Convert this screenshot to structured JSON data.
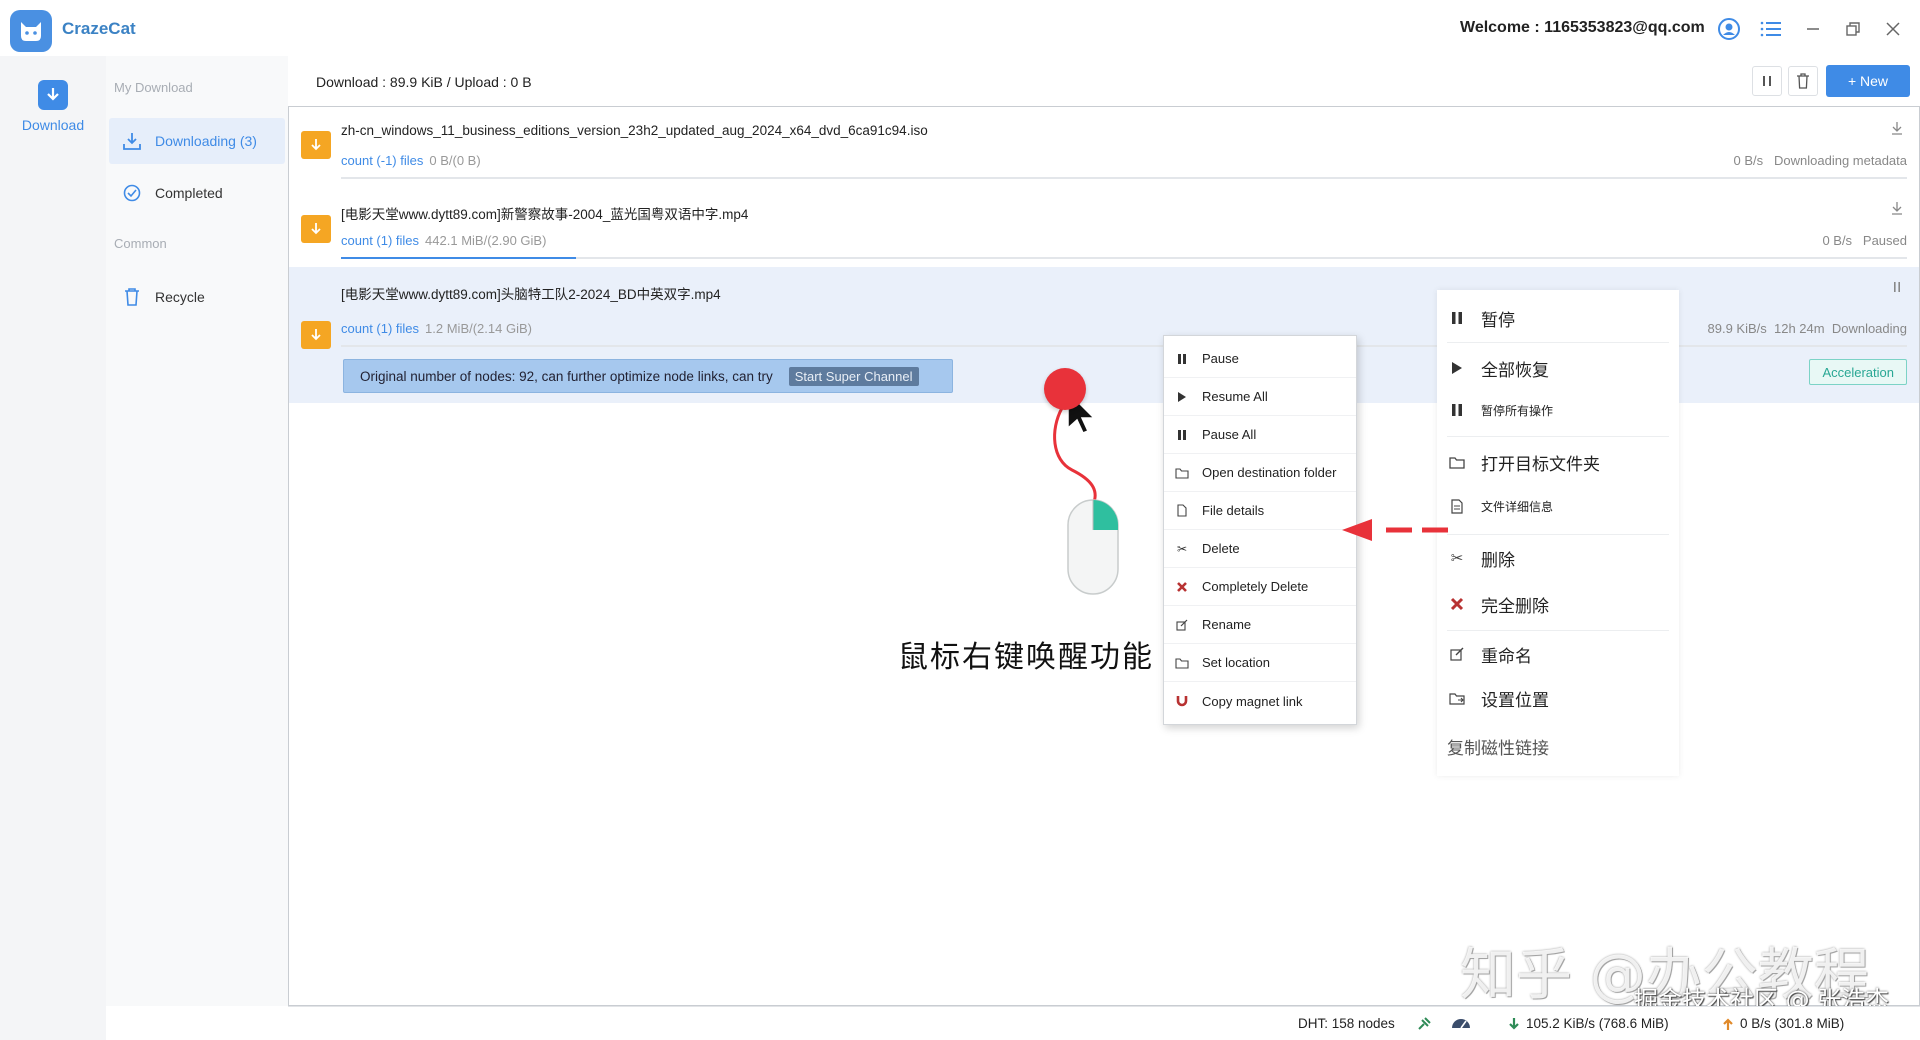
{
  "app": {
    "name": "CrazeCat",
    "welcome": "Welcome : 1165353823@qq.com"
  },
  "rail": {
    "download_label": "Download"
  },
  "sidebar": {
    "section_my": "My Download",
    "section_common": "Common",
    "items": [
      {
        "label": "Downloading (3)"
      },
      {
        "label": "Completed"
      },
      {
        "label": "Recycle"
      }
    ]
  },
  "topbar": {
    "stats": "Download : 89.9 KiB / Upload : 0 B",
    "new_label": "+ New"
  },
  "tasks": [
    {
      "name": "zh-cn_windows_11_business_editions_version_23h2_updated_aug_2024_x64_dvd_6ca91c94.iso",
      "count": "count (-1) files",
      "size": "0 B/(0 B)",
      "speed": "0 B/s",
      "status": "Downloading metadata",
      "progress": 0
    },
    {
      "name": "[电影天堂www.dytt89.com]新警察故事-2004_蓝光国粤双语中字.mp4",
      "count": "count (1) files",
      "size": "442.1 MiB/(2.90 GiB)",
      "speed": "0 B/s",
      "status": "Paused",
      "progress": 0.15
    },
    {
      "name": "[电影天堂www.dytt89.com]头脑特工队2-2024_BD中英双字.mp4",
      "count": "count (1) files",
      "size": "1.2 MiB/(2.14 GiB)",
      "speed": "89.9 KiB/s",
      "eta": "12h 24m",
      "status": "Downloading",
      "progress": 0.0
    }
  ],
  "notice": {
    "text": "Original number of nodes: 92, can further optimize node links, can try",
    "button": "Start Super Channel"
  },
  "acceleration_label": "Acceleration",
  "context_menu": [
    {
      "label": "Pause",
      "icon": "pause-icon"
    },
    {
      "label": "Resume All",
      "icon": "play-icon"
    },
    {
      "label": "Pause All",
      "icon": "pause-icon"
    },
    {
      "label": "Open destination folder",
      "icon": "folder-icon"
    },
    {
      "label": "File details",
      "icon": "file-icon"
    },
    {
      "label": "Delete",
      "icon": "scissors-icon"
    },
    {
      "label": "Completely Delete",
      "icon": "x-icon"
    },
    {
      "label": "Rename",
      "icon": "edit-icon"
    },
    {
      "label": "Set location",
      "icon": "location-icon"
    },
    {
      "label": "Copy magnet link",
      "icon": "magnet-icon"
    }
  ],
  "cn_menu": [
    {
      "label": "暂停"
    },
    {
      "label": "全部恢复"
    },
    {
      "label": "暂停所有操作"
    },
    {
      "label": "打开目标文件夹"
    },
    {
      "label": "文件详细信息"
    },
    {
      "label": "删除"
    },
    {
      "label": "完全删除"
    },
    {
      "label": "重命名"
    },
    {
      "label": "设置位置"
    },
    {
      "label": "复制磁性链接"
    }
  ],
  "annotation": {
    "caption": "鼠标右键唤醒功能"
  },
  "watermark": {
    "line1": "知乎 @办公教程",
    "line2": "掘金技术社区 @ 张浩杰"
  },
  "statusbar": {
    "dht": "DHT: 158 nodes",
    "down": "105.2 KiB/s (768.6 MiB)",
    "up": "0 B/s (301.8 MiB)"
  },
  "colors": {
    "accent": "#3f8be6",
    "folder": "#f5a623",
    "danger": "#c0392b",
    "teal": "#29a794"
  }
}
